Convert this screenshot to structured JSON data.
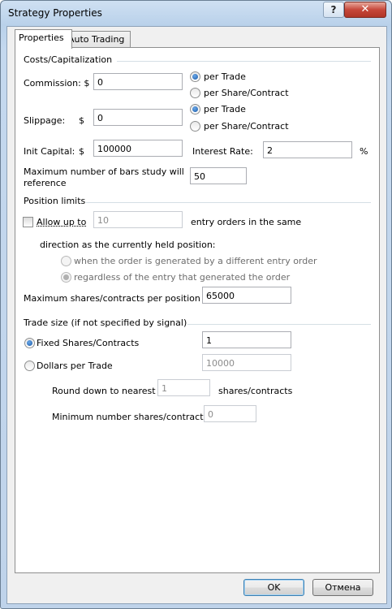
{
  "window": {
    "title": "Strategy Properties",
    "help_label": "?",
    "close_label": "✕"
  },
  "tabs": [
    {
      "label": "Properties"
    },
    {
      "label": "Auto Trading"
    }
  ],
  "costs": {
    "group_label": "Costs/Capitalization",
    "commission_label": "Commission: $",
    "commission_value": "0",
    "commission_options": [
      "per Trade",
      "per Share/Contract"
    ],
    "slippage_label": "Slippage:",
    "slippage_currency": "$",
    "slippage_value": "0",
    "slippage_options": [
      "per Trade",
      "per Share/Contract"
    ],
    "init_capital_label": "Init Capital:",
    "init_capital_currency": "$",
    "init_capital_value": "100000",
    "interest_rate_label": "Interest Rate:",
    "interest_rate_value": "2",
    "interest_rate_unit": "%",
    "max_bars_label_line1": "Maximum number of bars study will",
    "max_bars_label_line2": "reference",
    "max_bars_value": "50"
  },
  "position_limits": {
    "group_label": "Position limits",
    "allow_up_to_label": "Allow up to",
    "allow_up_to_value": "10",
    "entry_orders_label": "entry orders in the same",
    "direction_label": "direction as the currently held position:",
    "option_different": "when the order is generated by a different entry order",
    "option_regardless": "regardless of the entry that generated the order",
    "max_shares_label": "Maximum shares/contracts per position",
    "max_shares_value": "65000"
  },
  "trade_size": {
    "group_label": "Trade size (if not specified by signal)",
    "fixed_label": "Fixed Shares/Contracts",
    "fixed_value": "1",
    "dollars_label": "Dollars per Trade",
    "dollars_value": "10000",
    "round_down_label": "Round down to nearest",
    "round_down_value": "1",
    "round_down_unit": "shares/contracts",
    "min_shares_label": "Minimum number shares/contracts:",
    "min_shares_value": "0"
  },
  "footer": {
    "ok_label": "OK",
    "cancel_label": "Отмена"
  }
}
